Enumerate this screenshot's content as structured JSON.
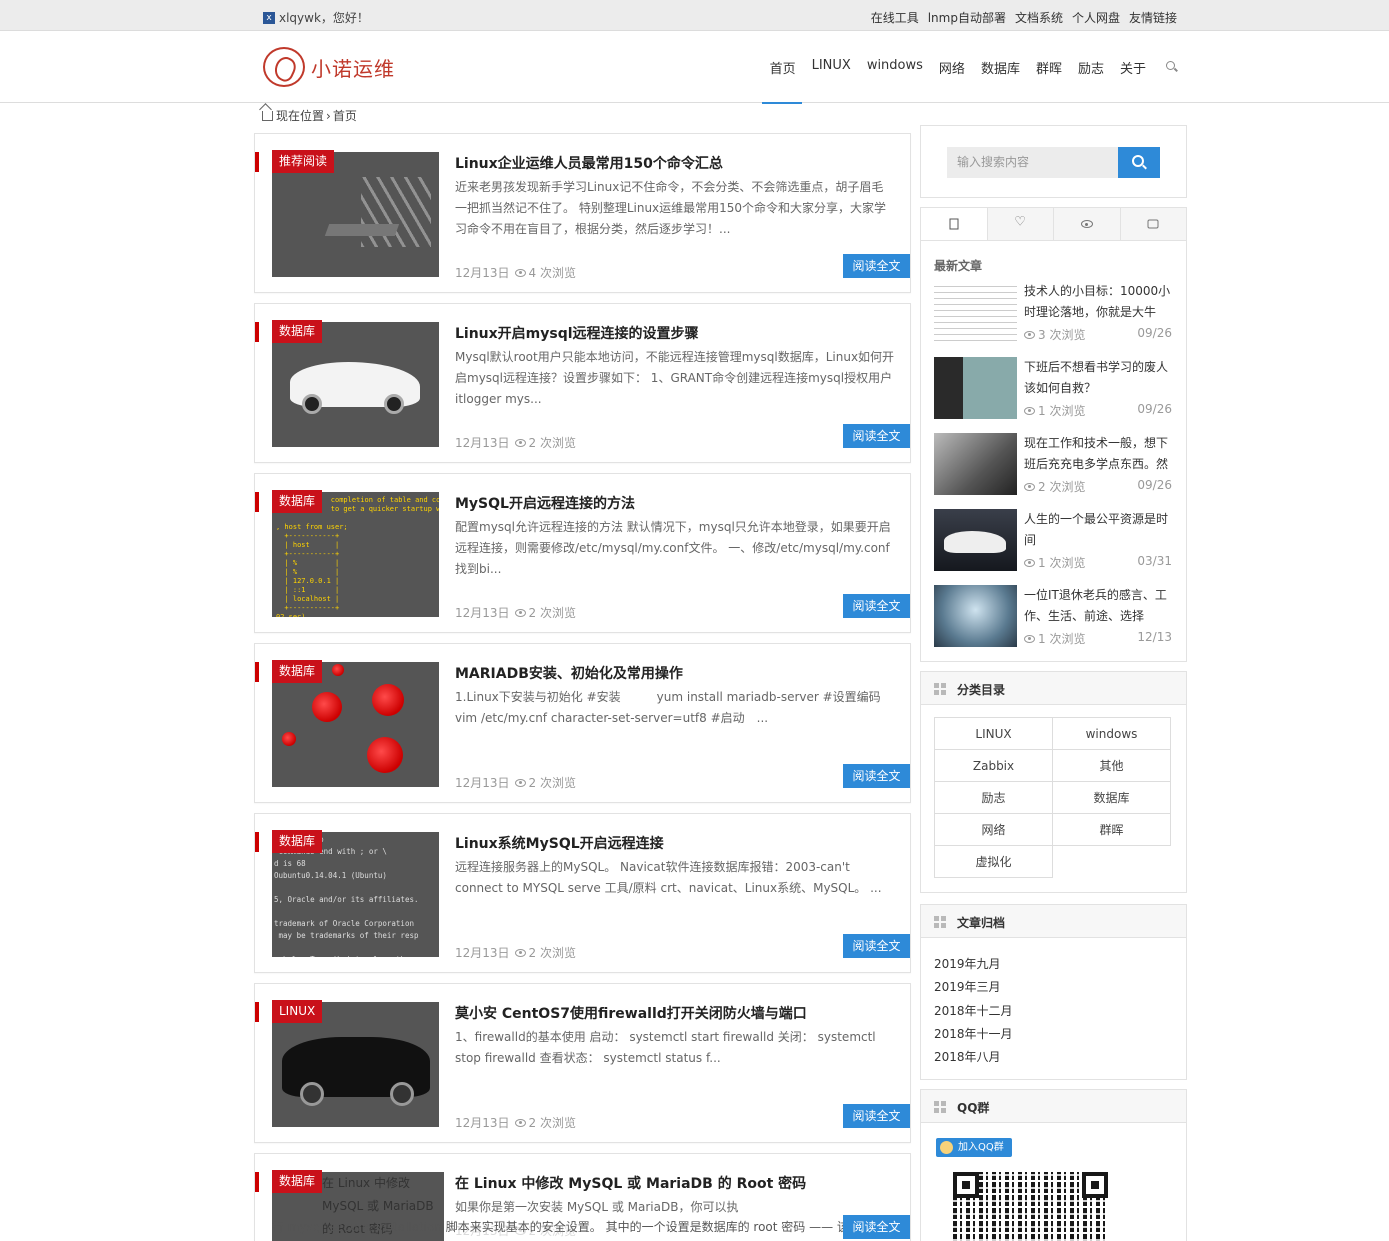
{
  "topbar": {
    "greeting": "xlqywk，您好！",
    "links": [
      "在线工具",
      "lnmp自动部署",
      "文档系统",
      "个人网盘",
      "友情链接"
    ]
  },
  "header": {
    "logo_text": "小诺运维",
    "nav": [
      "首页",
      "LINUX",
      "windows",
      "网络",
      "数据库",
      "群晖",
      "励志",
      "关于"
    ]
  },
  "breadcrumb": {
    "label": "现在位置",
    "sep": "›",
    "current": "首页"
  },
  "read_more": "阅读全文",
  "posts": [
    {
      "tag": "推荐阅读",
      "title": "Linux企业运维人员最常用150个命令汇总",
      "excerpt": "近来老男孩发现新手学习Linux记不住命令，不会分类、不会筛选重点，胡子眉毛一把抓当然记不住了。 特别整理Linux运维最常用150个命令和大家分享，大家学习命令不用在盲目了，根据分类，然后逐步学习！...",
      "date": "12月13日",
      "views": "4 次浏览"
    },
    {
      "tag": "数据库",
      "title": "Linux开启mysql远程连接的设置步骤",
      "excerpt": "Mysql默认root用户只能本地访问，不能远程连接管理mysql数据库，Linux如何开启mysql远程连接？设置步骤如下： 1、GRANT命令创建远程连接mysql授权用户itlogger mys...",
      "date": "12月13日",
      "views": "2 次浏览"
    },
    {
      "tag": "数据库",
      "title": "MySQL开启远程连接的方法",
      "excerpt": "配置mysql允许远程连接的方法 默认情况下，mysql只允许本地登录，如果要开启远程连接，则需要修改/etc/mysql/my.conf文件。 一、修改/etc/mysql/my.conf 找到bi...",
      "date": "12月13日",
      "views": "2 次浏览"
    },
    {
      "tag": "数据库",
      "title": "MARIADB安装、初始化及常用操作",
      "excerpt": "1.Linux下安装与初始化 #安装　　　yum install mariadb-server #设置编码　vim /etc/my.cnf character-set-server=utf8 #启动　...",
      "date": "12月13日",
      "views": "2 次浏览"
    },
    {
      "tag": "数据库",
      "title": "Linux系统MySQL开启远程连接",
      "excerpt": "远程连接服务器上的MySQL。 Navicat软件连接数据库报错：2003-can't connect to MYSQL serve 工具/原料 crt、navicat、Linux系统、MySQL。 ...",
      "date": "12月13日",
      "views": "2 次浏览"
    },
    {
      "tag": "LINUX",
      "title": "莫小安 CentOS7使用firewalld打开关闭防火墙与端口",
      "excerpt": "1、firewalld的基本使用 启动： systemctl start firewalld 关闭： systemctl stop firewalld 查看状态： systemctl status f...",
      "date": "12月13日",
      "views": "2 次浏览"
    },
    {
      "tag": "数据库",
      "title": "在 Linux 中修改 MySQL 或 MariaDB 的 Root 密码",
      "excerpt": "如果你是第一次安装 MySQL 或 MariaDB，你可以执",
      "excerpt_tail": "行 mysql_secure_installation 脚本来实现基本的安全设置。 其中的一个设置是数据库的 root 密码 —— 该密",
      "thumb_text": "在 Linux 中修改 MySQL 或 MariaDB 的 Root 密码",
      "date": "12月13日",
      "views": "2 次浏览"
    }
  ],
  "sidebar": {
    "search_placeholder": "输入搜索内容",
    "latest_title": "最新文章",
    "latest": [
      {
        "title": "技术人的小目标：10000小时理论落地，你就是大牛",
        "views": "3 次浏览",
        "date": "09/26"
      },
      {
        "title": "下班后不想看书学习的废人该如何自救？",
        "views": "1 次浏览",
        "date": "09/26"
      },
      {
        "title": "现在工作和技术一般，想下班后充充电多学点东西。然",
        "views": "2 次浏览",
        "date": "09/26"
      },
      {
        "title": "人生的一个最公平资源是时间",
        "views": "1 次浏览",
        "date": "03/31"
      },
      {
        "title": "一位IT退休老兵的感言、工作、生活、前途、选择",
        "views": "1 次浏览",
        "date": "12/13"
      }
    ],
    "categories_title": "分类目录",
    "categories": [
      "LINUX",
      "windows",
      "Zabbix",
      "其他",
      "励志",
      "数据库",
      "网络",
      "群晖",
      "虚拟化"
    ],
    "archive_title": "文章归档",
    "archives": [
      "2019年九月",
      "2019年三月",
      "2018年十二月",
      "2018年十一月",
      "2018年八月"
    ],
    "qq_title": "QQ群",
    "qq_button": "加入QQ群"
  }
}
